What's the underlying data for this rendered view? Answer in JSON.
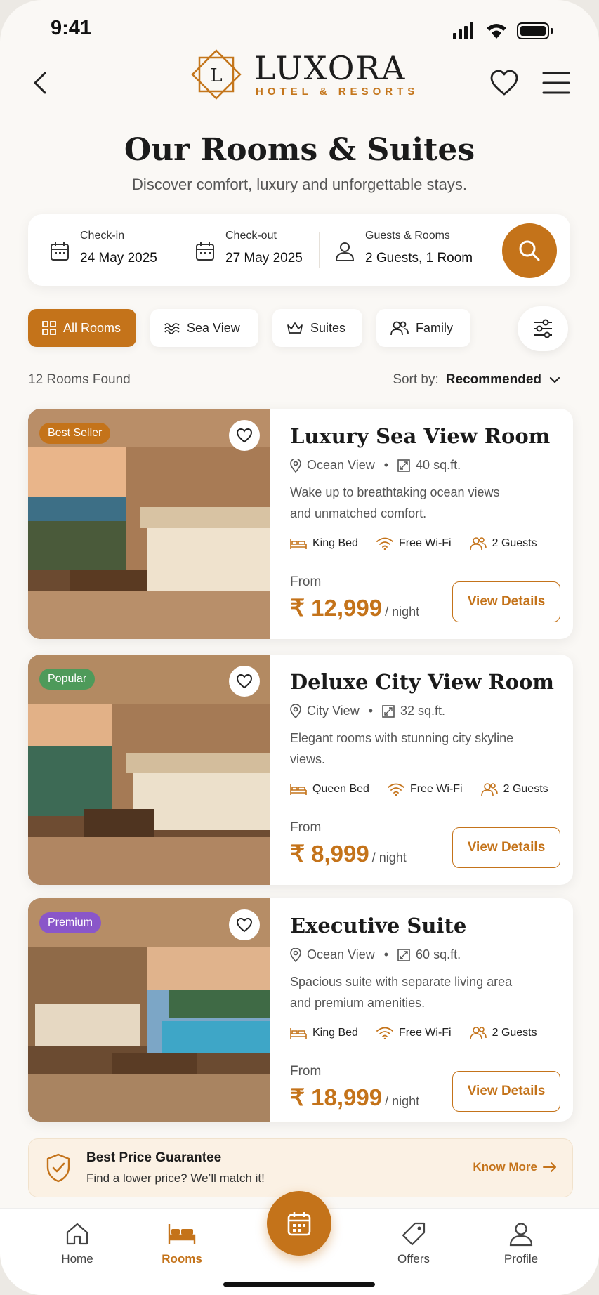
{
  "status": {
    "time": "9:41"
  },
  "brand": {
    "name": "LUXORA",
    "tagline": "HOTEL & RESORTS",
    "monogram": "L"
  },
  "page": {
    "title": "Our Rooms & Suites",
    "subtitle": "Discover comfort, luxury and unforgettable stays."
  },
  "search": {
    "checkin_label": "Check-in",
    "checkin_value": "24 May 2025",
    "checkout_label": "Check-out",
    "checkout_value": "27 May 2025",
    "guests_label": "Guests & Rooms",
    "guests_value": "2 Guests, 1 Room"
  },
  "chips": [
    "All Rooms",
    "Sea View",
    "Suites",
    "Family"
  ],
  "results": {
    "count": "12 Rooms Found",
    "sort_label": "Sort by:",
    "sort_value": "Recommended"
  },
  "rooms": [
    {
      "badge": "Best Seller",
      "badge_color": "#c4731a",
      "name": "Luxury Sea View Room",
      "view": "Ocean View",
      "size": "40 sq.ft.",
      "desc": "Wake up to breathtaking ocean views and unmatched comfort.",
      "bed": "King Bed",
      "wifi": "Free Wi-Fi",
      "guests": "2 Guests",
      "from": "From",
      "price": "₹ 12,999",
      "per": "/ night",
      "cta": "View Details"
    },
    {
      "badge": "Popular",
      "badge_color": "#4e9a5a",
      "name": "Deluxe City View Room",
      "view": "City View",
      "size": "32 sq.ft.",
      "desc": "Elegant rooms with stunning city skyline views.",
      "bed": "Queen Bed",
      "wifi": "Free Wi-Fi",
      "guests": "2 Guests",
      "from": "From",
      "price": "₹ 8,999",
      "per": "/ night",
      "cta": "View Details"
    },
    {
      "badge": "Premium",
      "badge_color": "#8a56c9",
      "name": "Executive Suite",
      "view": "Ocean View",
      "size": "60 sq.ft.",
      "desc": "Spacious suite with separate living area and premium amenities.",
      "bed": "King Bed",
      "wifi": "Free Wi-Fi",
      "guests": "2 Guests",
      "from": "From",
      "price": "₹ 18,999",
      "per": "/ night",
      "cta": "View Details"
    }
  ],
  "guarantee": {
    "title": "Best Price Guarantee",
    "subtitle": "Find a lower price? We’ll match it!",
    "link": "Know More"
  },
  "nav": {
    "home": "Home",
    "rooms": "Rooms",
    "offers": "Offers",
    "profile": "Profile"
  },
  "colors": {
    "accent": "#c4731a",
    "background": "#faf8f5"
  }
}
